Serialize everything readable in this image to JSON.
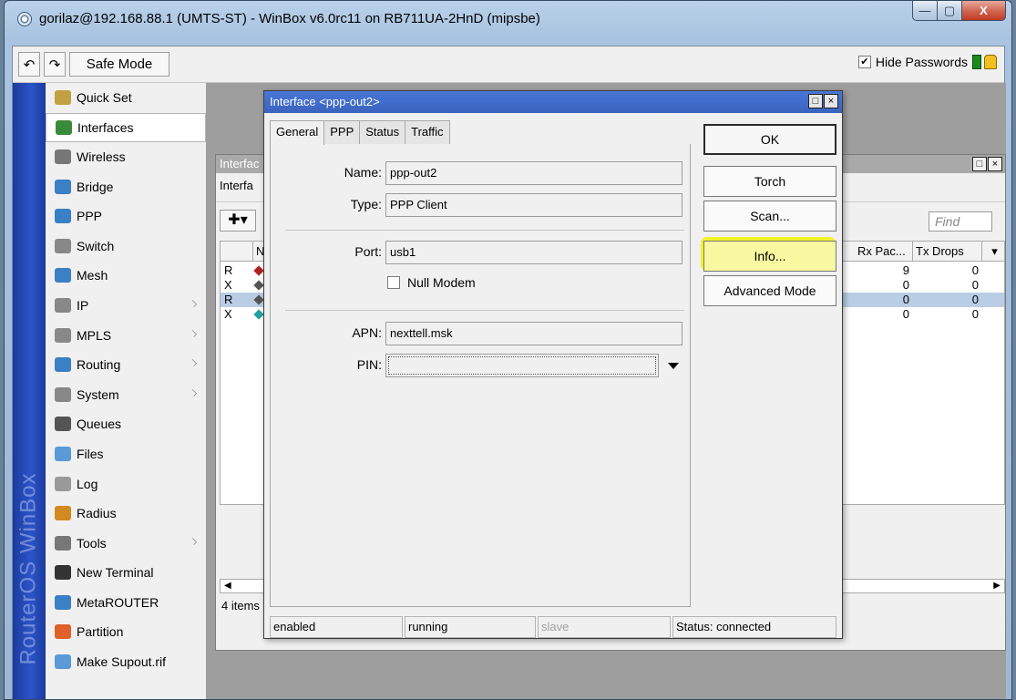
{
  "window": {
    "title": "gorilaz@192.168.88.1 (UMTS-ST) - WinBox v6.0rc11 on RB711UA-2HnD (mipsbe)",
    "min_glyph": "—",
    "max_glyph": "▢",
    "close_glyph": "X"
  },
  "toolbar": {
    "undo_glyph": "↶",
    "redo_glyph": "↷",
    "safe_mode_label": "Safe Mode",
    "hide_passwords_label": "Hide Passwords",
    "hide_passwords_checked": "✔"
  },
  "sidebar": {
    "brand": "RouterOS WinBox",
    "items": [
      {
        "label": "Quick Set",
        "icon": "quickset-icon",
        "color": "#c0a040"
      },
      {
        "label": "Interfaces",
        "icon": "interfaces-icon",
        "color": "#3b8a3b"
      },
      {
        "label": "Wireless",
        "icon": "wireless-icon",
        "color": "#777777"
      },
      {
        "label": "Bridge",
        "icon": "bridge-icon",
        "color": "#3b7fc4"
      },
      {
        "label": "PPP",
        "icon": "ppp-icon",
        "color": "#3b7fc4"
      },
      {
        "label": "Switch",
        "icon": "switch-icon",
        "color": "#888888"
      },
      {
        "label": "Mesh",
        "icon": "mesh-icon",
        "color": "#3b7fc4"
      },
      {
        "label": "IP",
        "icon": "ip-icon",
        "color": "#888888"
      },
      {
        "label": "MPLS",
        "icon": "mpls-icon",
        "color": "#888888"
      },
      {
        "label": "Routing",
        "icon": "routing-icon",
        "color": "#3b7fc4"
      },
      {
        "label": "System",
        "icon": "system-icon",
        "color": "#888888"
      },
      {
        "label": "Queues",
        "icon": "queues-icon",
        "color": "#555555"
      },
      {
        "label": "Files",
        "icon": "files-icon",
        "color": "#5a9ad6"
      },
      {
        "label": "Log",
        "icon": "log-icon",
        "color": "#999999"
      },
      {
        "label": "Radius",
        "icon": "radius-icon",
        "color": "#d08a20"
      },
      {
        "label": "Tools",
        "icon": "tools-icon",
        "color": "#777777"
      },
      {
        "label": "New Terminal",
        "icon": "terminal-icon",
        "color": "#333333"
      },
      {
        "label": "MetaROUTER",
        "icon": "metarouter-icon",
        "color": "#3b7fc4"
      },
      {
        "label": "Partition",
        "icon": "partition-icon",
        "color": "#e0602a"
      },
      {
        "label": "Make Supout.rif",
        "icon": "supout-icon",
        "color": "#5a9ad6"
      }
    ]
  },
  "iflist": {
    "title": "Interfac",
    "tab": "Interfa",
    "find_placeholder": "Find",
    "columns": {
      "n": "N",
      "rx": "Rx Pac...",
      "tx": "Tx Drops"
    },
    "rows": [
      {
        "flag": "R",
        "rx": "9",
        "tx": "0"
      },
      {
        "flag": "X",
        "rx": "0",
        "tx": "0"
      },
      {
        "flag": "R",
        "rx": "0",
        "tx": "0"
      },
      {
        "flag": "X",
        "rx": "0",
        "tx": "0"
      }
    ],
    "items_count": "4 items",
    "window_btns": "□×"
  },
  "dialog": {
    "title": "Interface <ppp-out2>",
    "tabs": [
      "General",
      "PPP",
      "Status",
      "Traffic"
    ],
    "fields": {
      "name_label": "Name:",
      "name_value": "ppp-out2",
      "type_label": "Type:",
      "type_value": "PPP Client",
      "port_label": "Port:",
      "port_value": "usb1",
      "null_modem_label": "Null Modem",
      "apn_label": "APN:",
      "apn_value": "nexttell.msk",
      "pin_label": "PIN:",
      "pin_value": ""
    },
    "buttons": [
      "OK",
      "Torch",
      "Scan...",
      "Info...",
      "Advanced Mode"
    ],
    "status": [
      "enabled",
      "running",
      "slave",
      "Status: connected"
    ]
  }
}
